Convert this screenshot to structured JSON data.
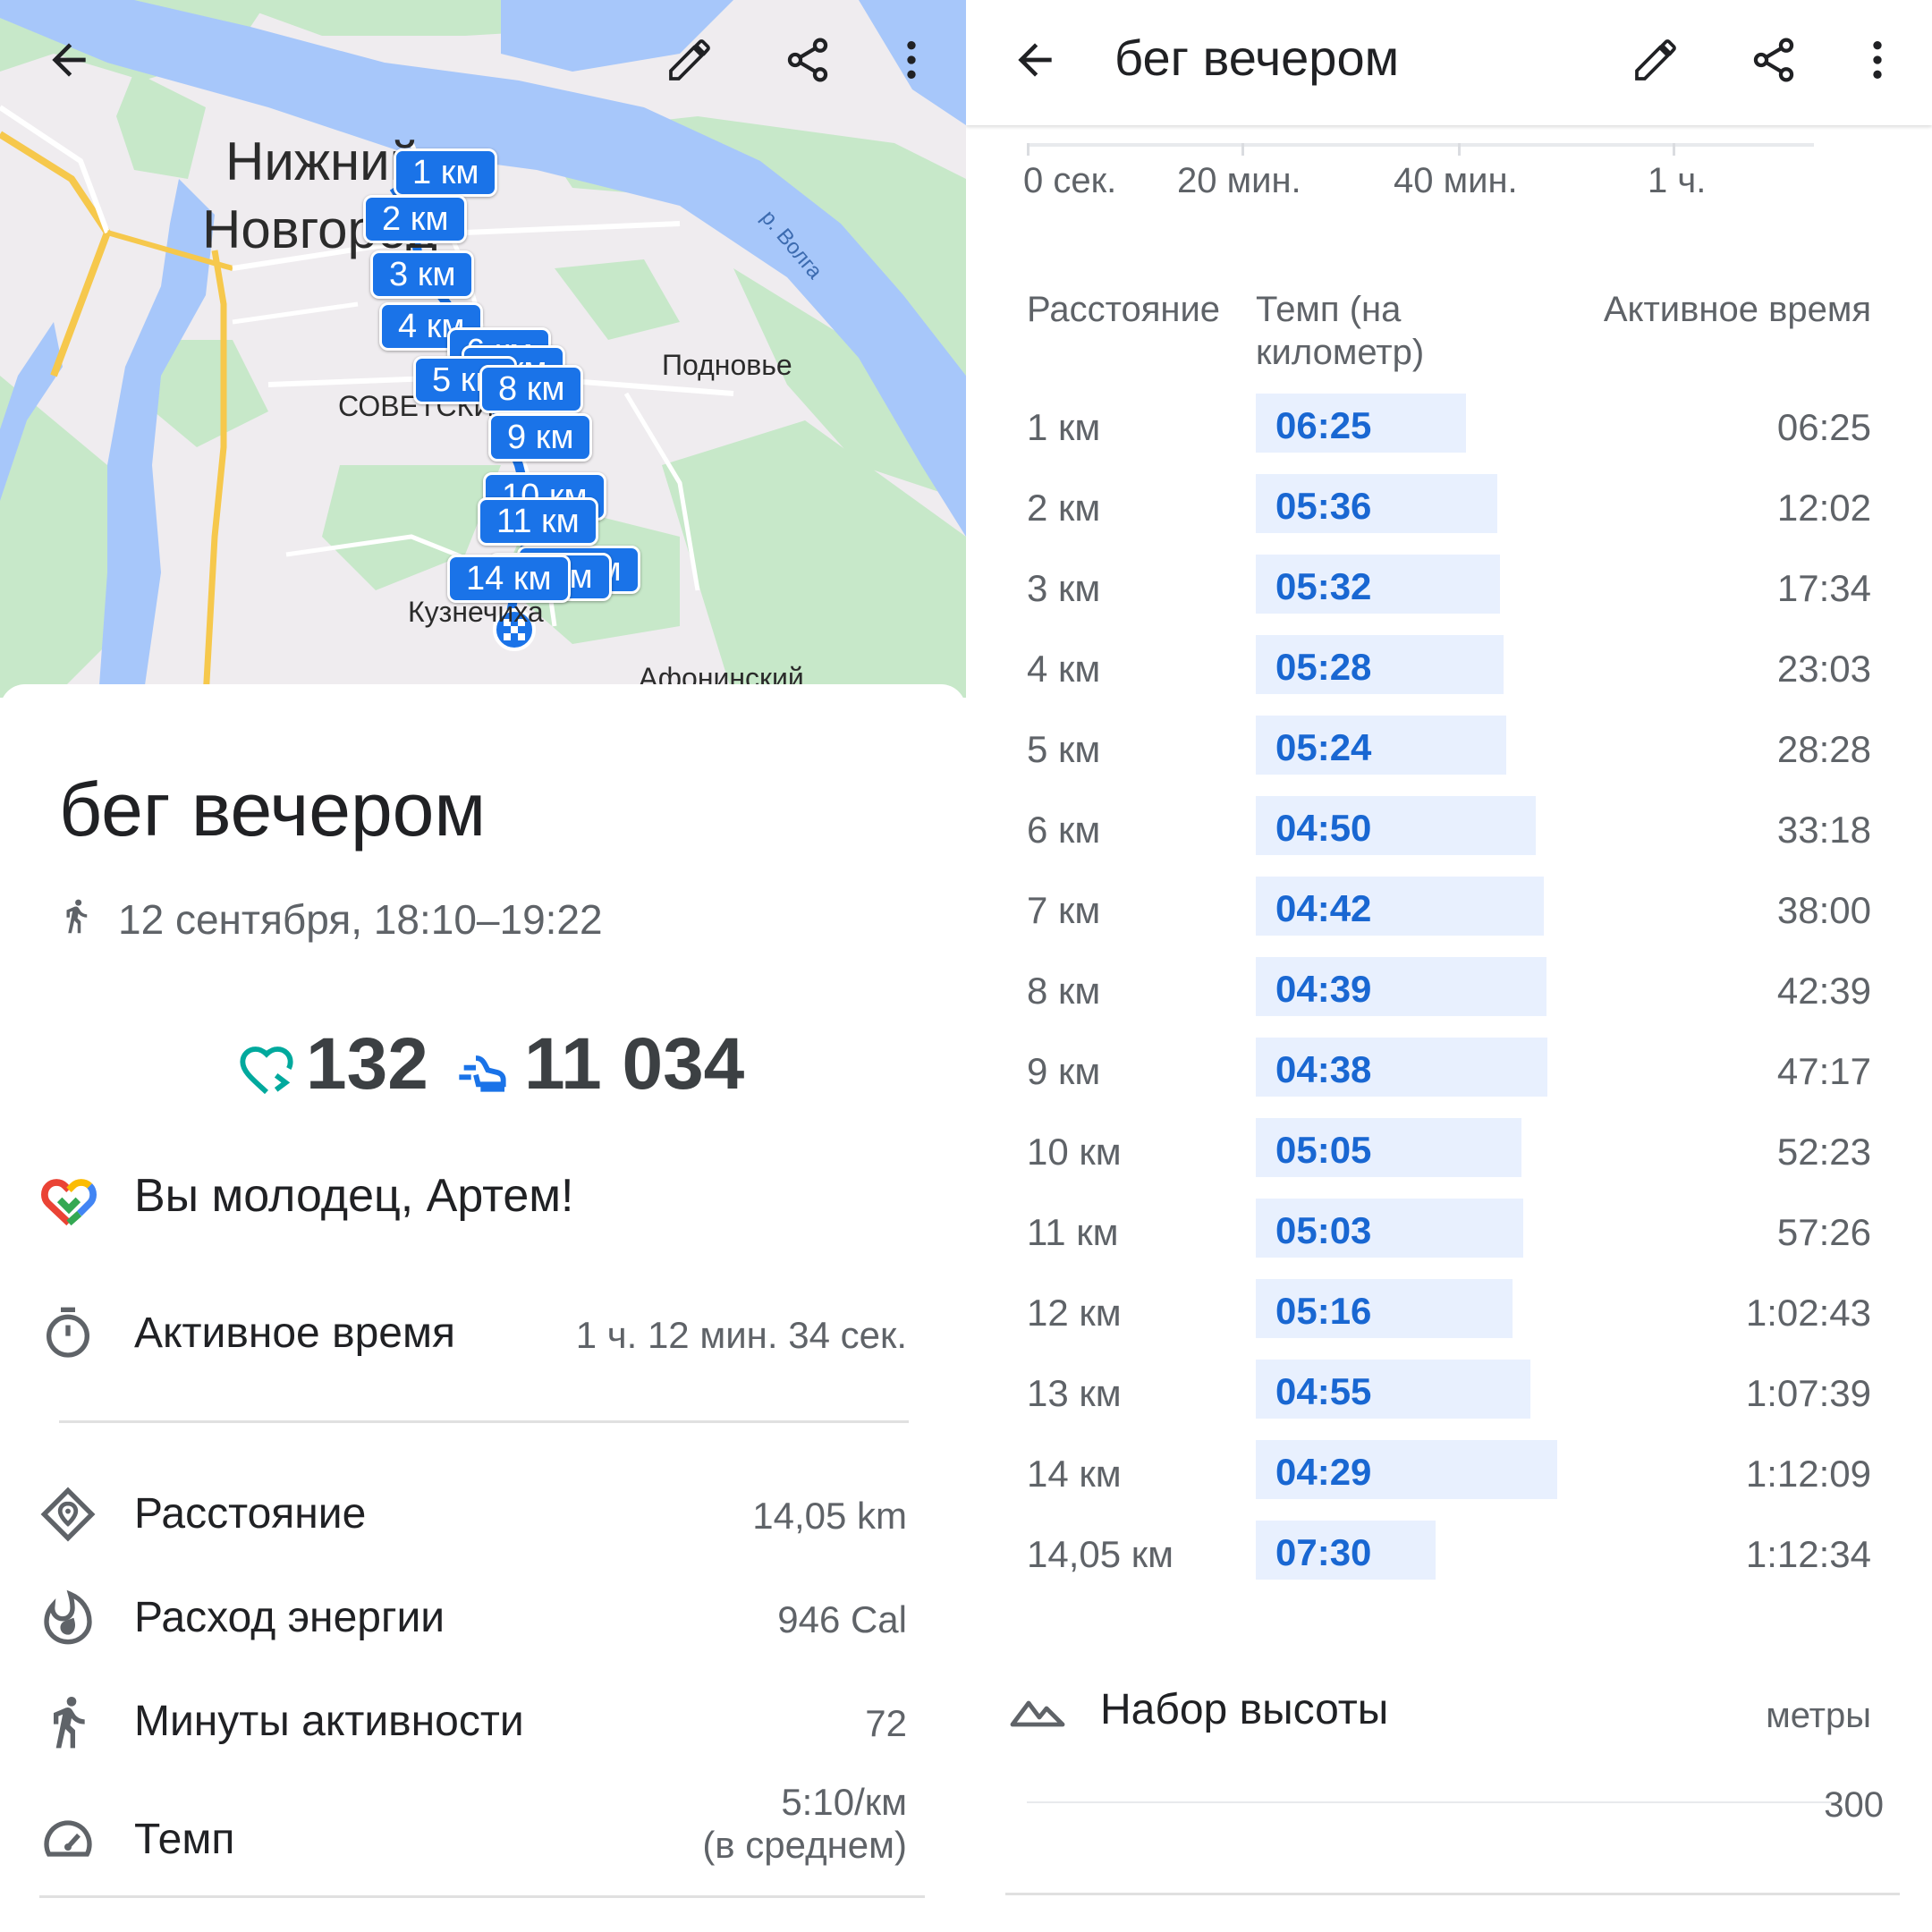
{
  "left": {
    "map": {
      "labels": {
        "city_line1": "Нижний",
        "city_line2": "Новгород",
        "river": "р. Волга",
        "district1": "Подновье",
        "district2": "СОВЕТСКИЙ",
        "district3": "Кузнечиха",
        "district4": "Афонинский"
      },
      "km_markers": [
        "1 км",
        "2 км",
        "3 км",
        "4 км",
        "5 км",
        "6 км",
        "7 км",
        "8 км",
        "9 км",
        "10 км",
        "11 км",
        "12 км",
        "13 км",
        "14 км"
      ]
    },
    "title": "бег вечером",
    "date": "12 сентября, 18:10–19:22",
    "heart_points": "132",
    "steps": "11 034",
    "cheer": "Вы молодец, Артем!",
    "active_time": {
      "label": "Активное время",
      "value": "1 ч. 12 мин. 34 сек."
    },
    "metrics": {
      "distance": {
        "label": "Расстояние",
        "value": "14,05 km"
      },
      "energy": {
        "label": "Расход энергии",
        "value": "946 Cal"
      },
      "move_minutes": {
        "label": "Минуты активности",
        "value": "72"
      },
      "pace": {
        "label": "Темп",
        "value_line1": "5:10/км",
        "value_line2": "(в среднем)"
      }
    }
  },
  "right": {
    "title": "бег вечером",
    "axis": [
      "0 сек.",
      "20 мин.",
      "40 мин.",
      "1 ч."
    ],
    "columns": {
      "distance": "Расстояние",
      "pace_line1": "Темп (на",
      "pace_line2": "километр)",
      "time": "Активное время"
    },
    "elevation": {
      "label": "Набор высоты",
      "unit": "метры",
      "tick": "300"
    }
  },
  "chart_data": {
    "type": "bar",
    "title": "",
    "categories": [
      "1 км",
      "2 км",
      "3 км",
      "4 км",
      "5 км",
      "6 км",
      "7 км",
      "8 км",
      "9 км",
      "10 км",
      "11 км",
      "12 км",
      "13 км",
      "14 км",
      "14,05 км"
    ],
    "pace_labels": [
      "06:25",
      "05:36",
      "05:32",
      "05:28",
      "05:24",
      "04:50",
      "04:42",
      "04:39",
      "04:38",
      "05:05",
      "05:03",
      "05:16",
      "04:55",
      "04:29",
      "07:30"
    ],
    "speed_kmh": [
      9.35,
      10.71,
      10.84,
      10.98,
      11.11,
      12.41,
      12.77,
      12.9,
      12.95,
      11.8,
      11.88,
      11.39,
      12.2,
      13.38,
      8.0
    ],
    "active_times": [
      "06:25",
      "12:02",
      "17:34",
      "23:03",
      "28:28",
      "33:18",
      "38:00",
      "42:39",
      "47:17",
      "52:23",
      "57:26",
      "1:02:43",
      "1:07:39",
      "1:12:09",
      "1:12:34"
    ]
  },
  "colors": {
    "accent": "#1a73e8",
    "pace_text": "#1967d2",
    "bar_bg": "#e8f0fe",
    "heart_teal": "#00a99d",
    "steps_blue": "#1a73e8",
    "water": "#a7c7fa",
    "park": "#c7e8c9"
  },
  "icons": [
    "back-arrow-icon",
    "edit-pencil-icon",
    "share-icon",
    "more-vert-icon",
    "walk-icon",
    "heart-points-icon",
    "steps-icon",
    "google-fit-heart-icon",
    "timer-icon",
    "location-diamond-icon",
    "flame-icon",
    "walking-person-icon",
    "speedometer-icon",
    "mountain-icon"
  ]
}
